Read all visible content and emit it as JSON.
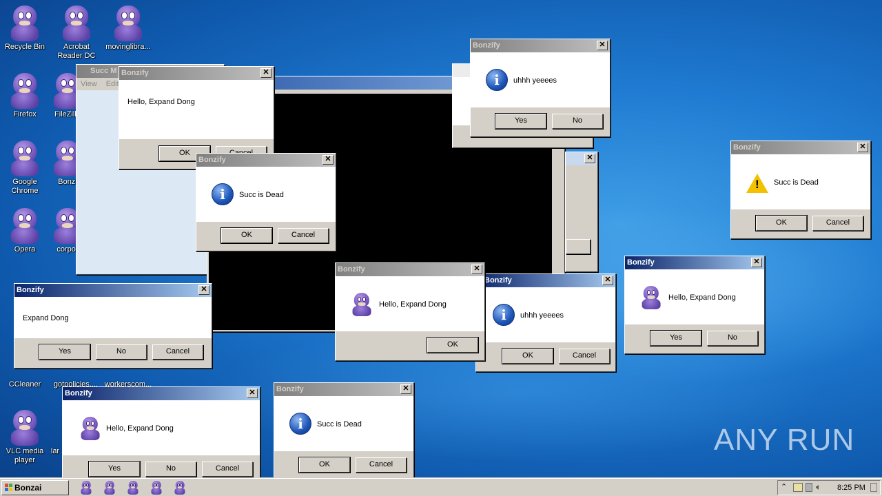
{
  "desktop_icons": [
    {
      "label": "Recycle Bin"
    },
    {
      "label": "Acrobat Reader DC"
    },
    {
      "label": "movinglibra..."
    },
    {
      "label": "Firefox"
    },
    {
      "label": "FileZilla"
    },
    {
      "label": "Google Chrome"
    },
    {
      "label": "Bonzi"
    },
    {
      "label": "Opera"
    },
    {
      "label": "corpor"
    },
    {
      "label": "CCleaner"
    },
    {
      "label": "gotpolicies...."
    },
    {
      "label": "workerscom..."
    },
    {
      "label": "VLC media player"
    },
    {
      "label": "lar"
    }
  ],
  "background_window": {
    "title": "Succ M",
    "menu_view": "View",
    "menu_edit": "Edit"
  },
  "dialogs": [
    {
      "title": "Bonzify",
      "text": "Hello, Expand Dong",
      "buttons": [
        "OK",
        "Cancel"
      ]
    },
    {
      "title": "Bonzify",
      "text": "Succ is Dead",
      "buttons": [
        "OK",
        "Cancel"
      ]
    },
    {
      "title": "Bonzify",
      "text": "uhhh yeeees",
      "buttons": [
        "Yes",
        "No"
      ]
    },
    {
      "title": "Bonzify",
      "text": "Succ is Dead",
      "buttons": [
        "OK",
        "Cancel"
      ]
    },
    {
      "title": "Bonzify",
      "text": "Expand Dong",
      "buttons": [
        "Yes",
        "No",
        "Cancel"
      ]
    },
    {
      "title": "Bonzify",
      "text": "Hello, Expand Dong",
      "buttons": [
        "OK"
      ]
    },
    {
      "title": "Bonzify",
      "text": "uhhh yeeees",
      "buttons": [
        "OK",
        "Cancel"
      ]
    },
    {
      "title": "Bonzify",
      "text": "Hello, Expand Dong",
      "buttons": [
        "Yes",
        "No"
      ]
    },
    {
      "title": "Bonzify",
      "text": "Hello, Expand Dong",
      "buttons": [
        "Yes",
        "No",
        "Cancel"
      ]
    },
    {
      "title": "Bonzify",
      "text": "Succ is Dead",
      "buttons": [
        "OK",
        "Cancel"
      ]
    }
  ],
  "taskbar": {
    "start_label": "Bonzai Buhdy",
    "clock": "8:25 PM",
    "quicklaunch_icons": [
      "bonzi-icon",
      "bonzi-icon",
      "bonzi-icon",
      "bonzi-icon",
      "bonzi-icon"
    ]
  },
  "watermark": "ANY RUN",
  "colors": {
    "titlebar_active": "#0a246a",
    "dialog_face": "#d4d0c8",
    "desktop": "#1f7bd1"
  }
}
